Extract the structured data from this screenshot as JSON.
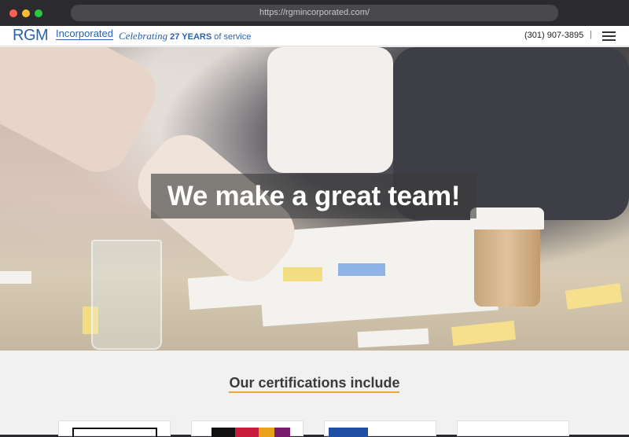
{
  "browser": {
    "url": "https://rgmincorporated.com/"
  },
  "header": {
    "logo_main": "RGM",
    "logo_sub": "Incorporated",
    "tagline_celebrating": "Celebrating",
    "tagline_years": "27 YEARS",
    "tagline_service": "of service",
    "phone": "(301) 907-3895",
    "separator": "|",
    "menu_icon": "hamburger-menu-icon"
  },
  "hero": {
    "title": "We make a great team!"
  },
  "certifications": {
    "heading": "Our certifications include",
    "cards": [
      {
        "name": "certification-1"
      },
      {
        "name": "certification-2"
      },
      {
        "name": "certification-3"
      },
      {
        "name": "certification-4"
      }
    ]
  },
  "colors": {
    "brand_blue": "#2a62ad",
    "accent_orange": "#e6a63a",
    "hero_overlay": "#3c3c3c"
  }
}
